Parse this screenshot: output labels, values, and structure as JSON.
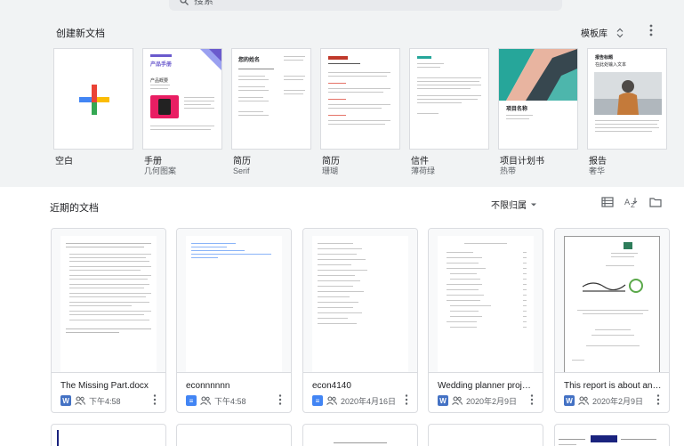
{
  "search": {
    "text": "搜索"
  },
  "gallery": {
    "title": "创建新文档",
    "library_label": "模板库",
    "templates": [
      {
        "name": "空白",
        "sub": ""
      },
      {
        "name": "手册",
        "sub": "几何图案",
        "preview_title": "产品手册",
        "preview_heading": "产品概要"
      },
      {
        "name": "简历",
        "sub": "Serif",
        "preview_title": "您的姓名"
      },
      {
        "name": "简历",
        "sub": "珊瑚"
      },
      {
        "name": "信件",
        "sub": "薄荷绿"
      },
      {
        "name": "项目计划书",
        "sub": "热带",
        "preview_title": "项目名称"
      },
      {
        "name": "报告",
        "sub": "奢华",
        "preview_title": "报告标题",
        "preview_subtitle": "在此处输入文本"
      }
    ]
  },
  "recent": {
    "title": "近期的文档",
    "filter_label": "不限归属",
    "docs": [
      {
        "name": "The Missing Part.docx",
        "type": "W",
        "date": "下午4:58"
      },
      {
        "name": "econnnnnn",
        "type": "D",
        "date": "下午4:58"
      },
      {
        "name": "econ4140",
        "type": "D",
        "date": "2020年4月16日"
      },
      {
        "name": "Wedding planner project...",
        "type": "W",
        "date": "2020年2月9日"
      },
      {
        "name": "This report is about an int...",
        "type": "W",
        "date": "2020年2月9日"
      }
    ]
  },
  "colors": {
    "google_blue": "#4285f4",
    "google_red": "#ea4335",
    "google_yellow": "#fbbc04",
    "google_green": "#34a853",
    "word_blue": "#4472c4",
    "gallery_bg": "#f1f3f4"
  },
  "icons": [
    "search-icon",
    "sort-updown-icon",
    "more-vert-icon",
    "dropdown-arrow-icon",
    "list-view-icon",
    "sort-az-icon",
    "folder-icon",
    "shared-people-icon",
    "word-file-icon",
    "docs-file-icon"
  ]
}
